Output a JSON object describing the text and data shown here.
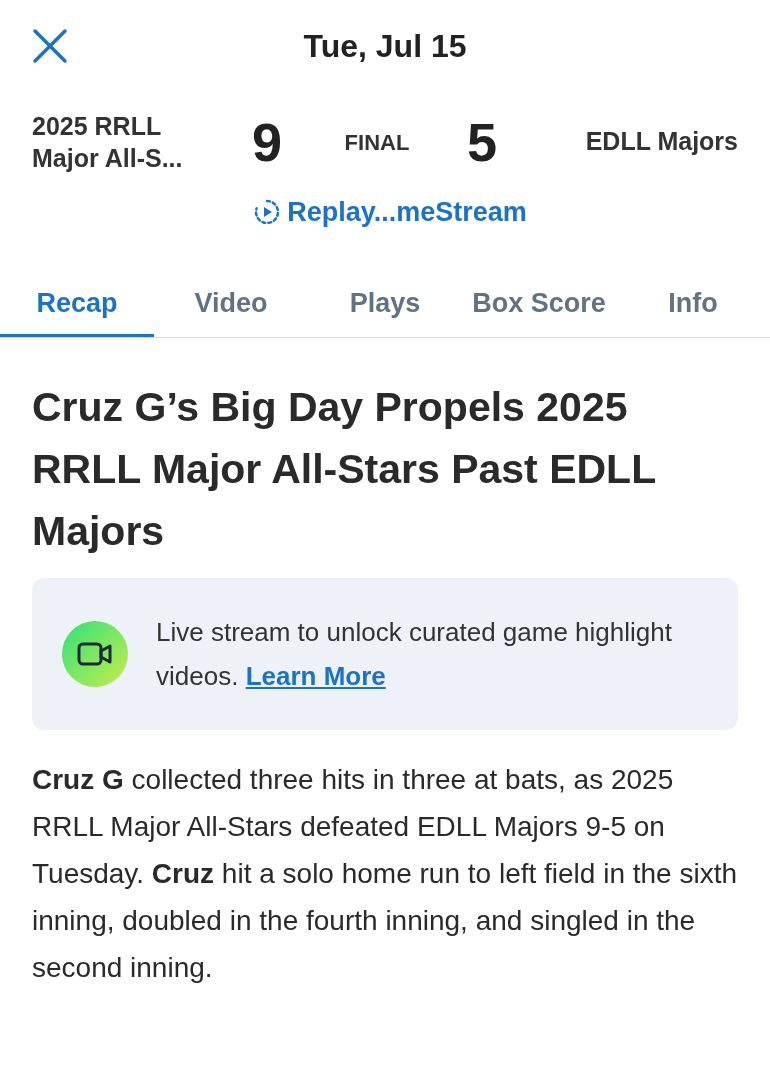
{
  "header": {
    "title": "Tue, Jul 15"
  },
  "score": {
    "home_team": "2025 RRLL Major All-S...",
    "home_score": "9",
    "status": "FINAL",
    "away_score": "5",
    "away_team": "EDLL Majors",
    "replay_link": "Replay...meStream"
  },
  "tabs": [
    {
      "label": "Recap",
      "selected": true
    },
    {
      "label": "Video",
      "selected": false
    },
    {
      "label": "Plays",
      "selected": false
    },
    {
      "label": "Box Score",
      "selected": false
    },
    {
      "label": "Info",
      "selected": false
    }
  ],
  "recap": {
    "headline": "Cruz G’s Big Day Propels 2025 RRLL Major All-Stars Past EDLL Majors",
    "banner": {
      "text": "Live stream to unlock curated game highlight videos.",
      "link": "Learn More"
    },
    "body": "**Cruz G** collected three hits in three at bats, as 2025 RRLL Major All-Stars defeated EDLL Majors 9-5 on Tuesday. **Cruz** hit a solo home run to left field in the sixth inning, doubled in the fourth inning, and singled in the second inning."
  }
}
